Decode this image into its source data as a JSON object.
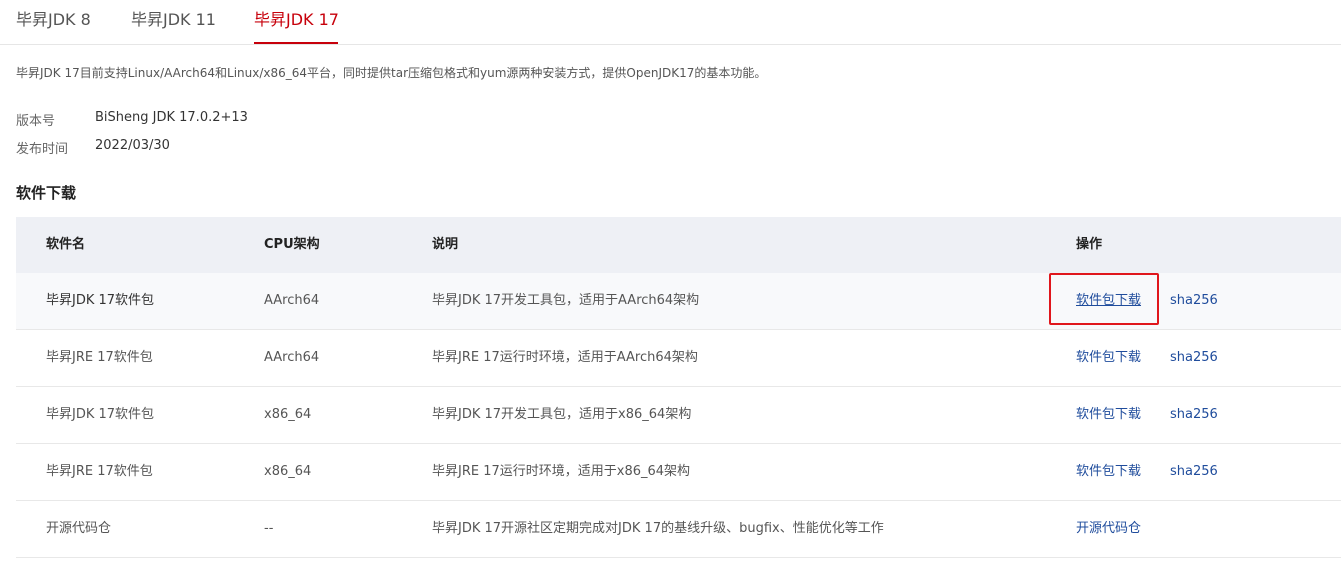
{
  "tabs": [
    {
      "label": "毕昇JDK 8",
      "active": false
    },
    {
      "label": "毕昇JDK 11",
      "active": false
    },
    {
      "label": "毕昇JDK 17",
      "active": true
    }
  ],
  "description": "毕昇JDK 17目前支持Linux/AArch64和Linux/x86_64平台，同时提供tar压缩包格式和yum源两种安装方式，提供OpenJDK17的基本功能。",
  "meta": {
    "version_label": "版本号",
    "version_value": "BiSheng JDK 17.0.2+13",
    "date_label": "发布时间",
    "date_value": "2022/03/30"
  },
  "section_title": "软件下载",
  "table": {
    "headers": [
      "软件名",
      "CPU架构",
      "说明",
      "操作"
    ],
    "rows": [
      {
        "name": "毕昇JDK 17软件包",
        "arch": "AArch64",
        "desc": "毕昇JDK 17开发工具包，适用于AArch64架构",
        "action": "软件包下载",
        "sha": "sha256"
      },
      {
        "name": "毕昇JRE 17软件包",
        "arch": "AArch64",
        "desc": "毕昇JRE 17运行时环境，适用于AArch64架构",
        "action": "软件包下载",
        "sha": "sha256"
      },
      {
        "name": "毕昇JDK 17软件包",
        "arch": "x86_64",
        "desc": "毕昇JDK 17开发工具包，适用于x86_64架构",
        "action": "软件包下载",
        "sha": "sha256"
      },
      {
        "name": "毕昇JRE 17软件包",
        "arch": "x86_64",
        "desc": "毕昇JRE 17运行时环境，适用于x86_64架构",
        "action": "软件包下载",
        "sha": "sha256"
      },
      {
        "name": "开源代码仓",
        "arch": "--",
        "desc": "毕昇JDK 17开源社区定期完成对JDK 17的基线升级、bugfix、性能优化等工作",
        "action": "开源代码仓",
        "sha": ""
      }
    ]
  },
  "colors": {
    "active_tab": "#c7000b",
    "link": "#1f4c9c",
    "highlight": "#e0161c",
    "header_bg": "#eef0f5"
  }
}
